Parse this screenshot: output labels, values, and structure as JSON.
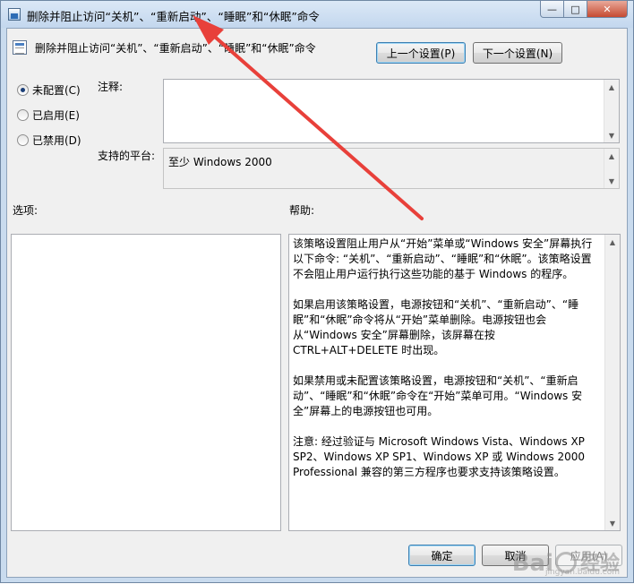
{
  "window": {
    "title": "删除并阻止访问“关机”、“重新启动”、“睡眠”和“休眠”命令",
    "controls": {
      "minimize": "—",
      "maximize": "□",
      "close": "✕"
    }
  },
  "header": {
    "policy_name": "删除并阻止访问“关机”、“重新启动”、“睡眠”和“休眠”命令",
    "prev_button": "上一个设置(P)",
    "next_button": "下一个设置(N)"
  },
  "state": {
    "options": [
      {
        "label": "未配置(C)",
        "checked": true
      },
      {
        "label": "已启用(E)",
        "checked": false
      },
      {
        "label": "已禁用(D)",
        "checked": false
      }
    ]
  },
  "comment": {
    "label": "注释:",
    "value": ""
  },
  "platform": {
    "label": "支持的平台:",
    "value": "至少 Windows 2000"
  },
  "options_section": {
    "label": "选项:"
  },
  "help_section": {
    "label": "帮助:",
    "paragraphs": [
      "该策略设置阻止用户从“开始”菜单或“Windows 安全”屏幕执行以下命令: “关机”、“重新启动”、“睡眠”和“休眠”。该策略设置不会阻止用户运行执行这些功能的基于 Windows 的程序。",
      "如果启用该策略设置，电源按钮和“关机”、“重新启动”、“睡眠”和“休眠”命令将从“开始”菜单删除。电源按钮也会从“Windows 安全”屏幕删除，该屏幕在按 CTRL+ALT+DELETE 时出现。",
      "如果禁用或未配置该策略设置，电源按钮和“关机”、“重新启动”、“睡眠”和“休眠”命令在“开始”菜单可用。“Windows 安全”屏幕上的电源按钮也可用。",
      "注意: 经过验证与 Microsoft Windows Vista、Windows XP SP2、Windows XP SP1、Windows XP 或 Windows 2000 Professional 兼容的第三方程序也要求支持该策略设置。"
    ]
  },
  "footer": {
    "ok_button": "确定",
    "cancel_button": "取消",
    "apply_button": "应用(A)"
  },
  "watermark": {
    "brand": "Bai",
    "suffix": "经验",
    "url": "jingyan.baidu.com"
  },
  "colors": {
    "annotation_arrow": "#e8403a",
    "title_bar": "#c9dbee"
  }
}
